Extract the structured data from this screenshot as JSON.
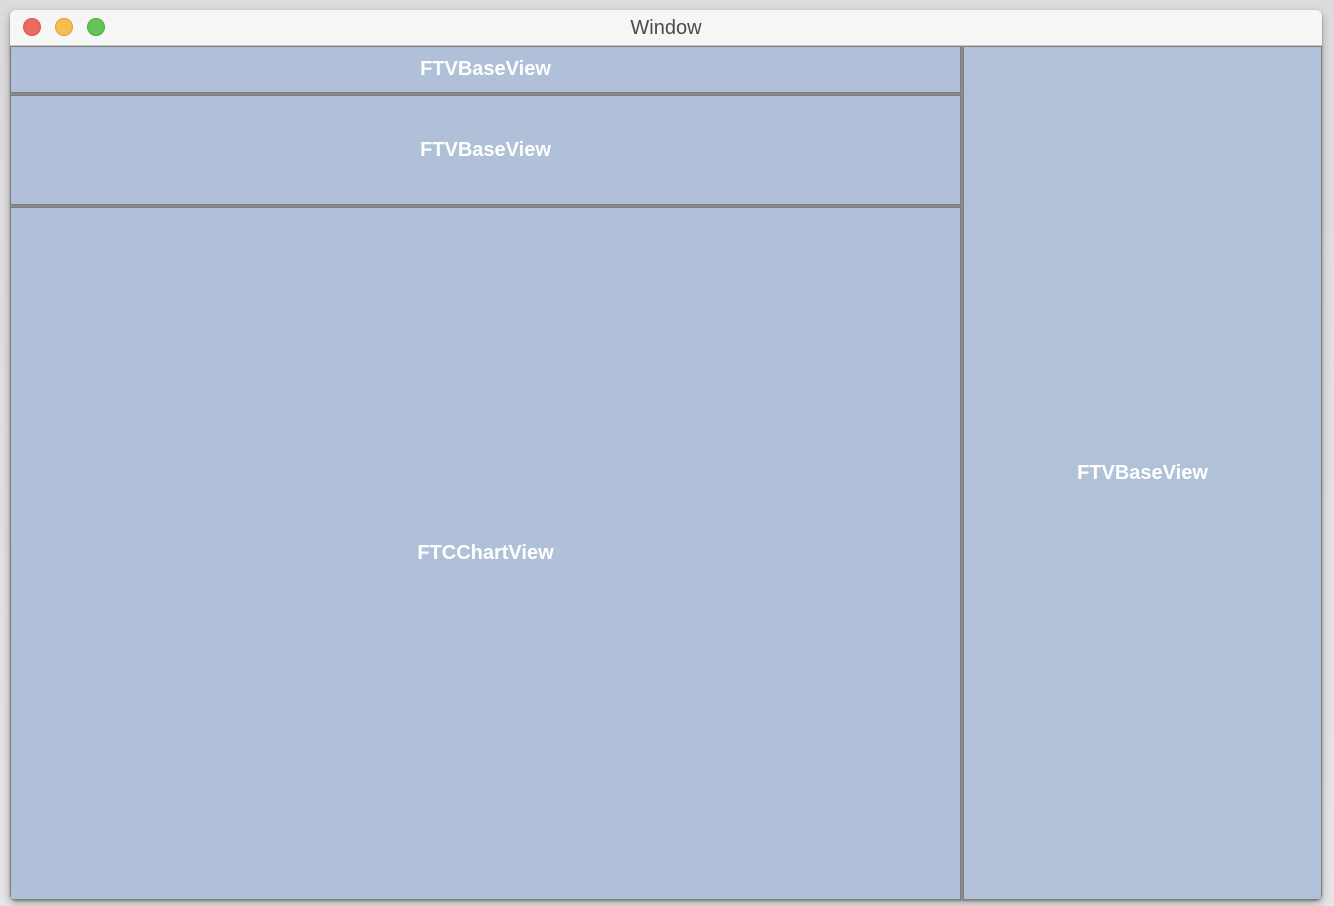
{
  "window": {
    "title": "Window"
  },
  "panels": {
    "top_base_view": "FTVBaseView",
    "middle_base_view": "FTVBaseView",
    "chart_view": "FTCChartView",
    "right_base_view": "FTVBaseView"
  },
  "colors": {
    "panel_fill": "#afc0d8",
    "close": "#ee6a5f",
    "minimize": "#f5be4f",
    "zoom": "#61c454"
  }
}
